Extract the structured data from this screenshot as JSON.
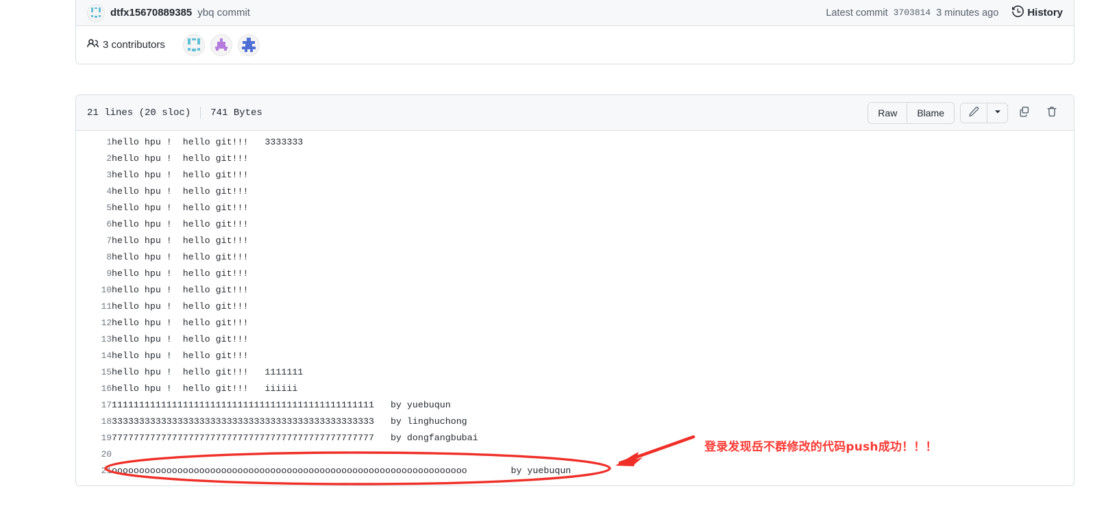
{
  "commit_bar": {
    "author": "dtfx15670889385",
    "message": "ybq commit",
    "latest_commit_label": "Latest commit",
    "sha": "3703814",
    "time": "3 minutes ago",
    "history_label": "History",
    "avatar_icon": "identicon-avatar",
    "history_icon": "clock-history-icon"
  },
  "contributors": {
    "icon": "people-icon",
    "label": "3 contributors",
    "avatars": [
      {
        "name": "contributor-avatar-1",
        "color": "#5fc0d6"
      },
      {
        "name": "contributor-avatar-2",
        "color": "#b57bdd"
      },
      {
        "name": "contributor-avatar-3",
        "color": "#4f6fd6"
      }
    ]
  },
  "file_header": {
    "lines_info": "21 lines (20 sloc)",
    "size_info": "741 Bytes",
    "raw_label": "Raw",
    "blame_label": "Blame",
    "edit_icon": "pencil-icon",
    "caret_icon": "chevron-down-icon",
    "copy_icon": "copy-icon",
    "delete_icon": "trash-icon"
  },
  "code": {
    "lines": [
      {
        "n": "1",
        "text": "hello hpu !  hello git!!!   3333333"
      },
      {
        "n": "2",
        "text": "hello hpu !  hello git!!!"
      },
      {
        "n": "3",
        "text": "hello hpu !  hello git!!!"
      },
      {
        "n": "4",
        "text": "hello hpu !  hello git!!!"
      },
      {
        "n": "5",
        "text": "hello hpu !  hello git!!!"
      },
      {
        "n": "6",
        "text": "hello hpu !  hello git!!!"
      },
      {
        "n": "7",
        "text": "hello hpu !  hello git!!!"
      },
      {
        "n": "8",
        "text": "hello hpu !  hello git!!!"
      },
      {
        "n": "9",
        "text": "hello hpu !  hello git!!!"
      },
      {
        "n": "10",
        "text": "hello hpu !  hello git!!!"
      },
      {
        "n": "11",
        "text": "hello hpu !  hello git!!!"
      },
      {
        "n": "12",
        "text": "hello hpu !  hello git!!!"
      },
      {
        "n": "13",
        "text": "hello hpu !  hello git!!!"
      },
      {
        "n": "14",
        "text": "hello hpu !  hello git!!!"
      },
      {
        "n": "15",
        "text": "hello hpu !  hello git!!!   1111111"
      },
      {
        "n": "16",
        "text": "hello hpu !  hello git!!!   iiiiii"
      },
      {
        "n": "17",
        "text": "111111111111111111111111111111111111111111111111   by yuebuqun"
      },
      {
        "n": "18",
        "text": "333333333333333333333333333333333333333333333333   by linghuchong"
      },
      {
        "n": "19",
        "text": "777777777777777777777777777777777777777777777777   by dongfangbubai"
      },
      {
        "n": "20",
        "text": ""
      },
      {
        "n": "21",
        "text": "ooooooooooooooooooooooooooooooooooooooooooooooooooooooooooooooooo        by yuebuqun"
      }
    ]
  },
  "annotation": {
    "text": "登录发现岳不群修改的代码push成功！！！",
    "color": "#fc3a34",
    "oval_name": "red-oval-highlight",
    "arrow_name": "red-arrow"
  }
}
